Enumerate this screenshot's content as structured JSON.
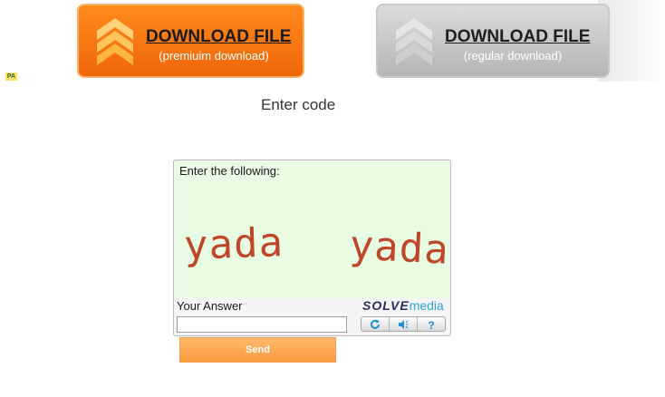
{
  "downloads": {
    "premium": {
      "title": "DOWNLOAD FILE",
      "subtitle": "(premiuim download)"
    },
    "regular": {
      "title": "DOWNLOAD FILE",
      "subtitle": "(regular download)"
    }
  },
  "pa_tag": "PA",
  "enter_code_label": "Enter code",
  "captcha": {
    "instruction": "Enter the following:",
    "challenge_words": [
      "yada",
      "yada"
    ],
    "answer_label": "Your Answer",
    "answer_value": "",
    "brand_part1": "SOLVE",
    "brand_part2": "media",
    "controls": [
      "refresh-icon",
      "audio-icon",
      "help-icon"
    ]
  },
  "send_label": "Send",
  "colors": {
    "premium": "#f47212",
    "regular": "#bdbdbd",
    "captcha_text": "#c0462a",
    "captcha_bg": "#e8fbe3",
    "send": "#fba54f"
  }
}
